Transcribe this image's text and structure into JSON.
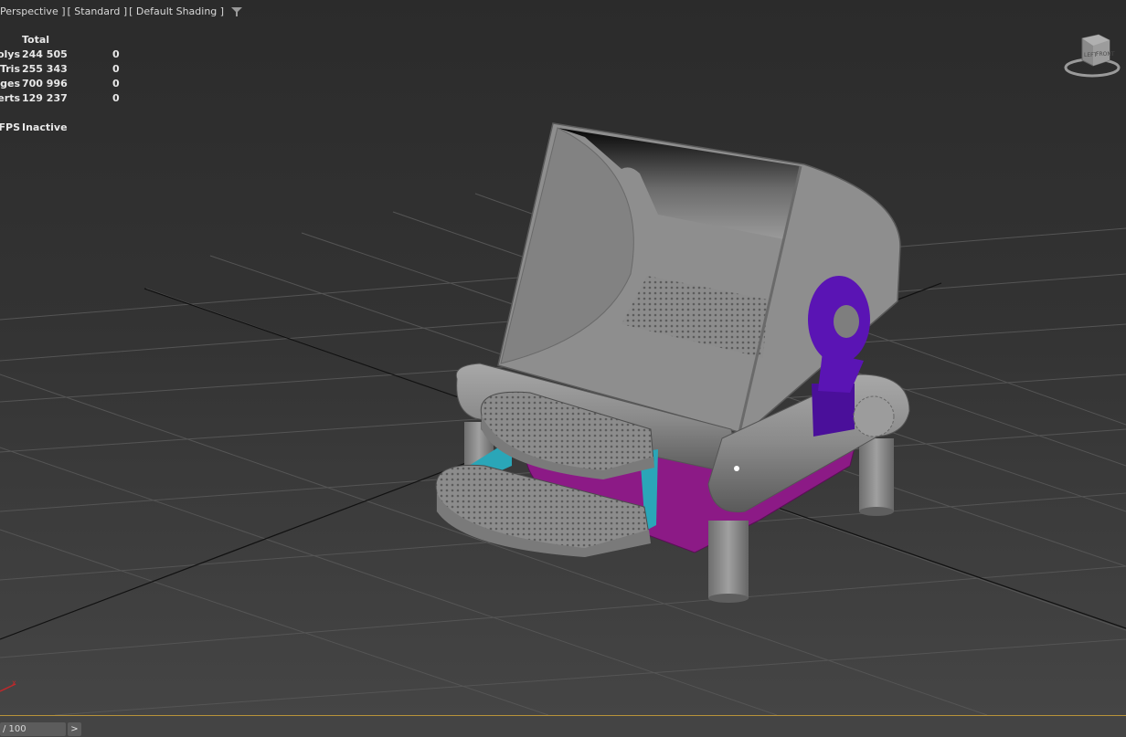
{
  "viewport": {
    "label_items": [
      "Perspective ]",
      "[ Standard ]",
      "[ Default Shading ]"
    ],
    "filter_icon": "filter-icon"
  },
  "stats": {
    "header": "Total",
    "rows": [
      {
        "label": "Polys:",
        "total": "244 505",
        "selected": "0"
      },
      {
        "label": "Tris:",
        "total": "255 343",
        "selected": "0"
      },
      {
        "label": "Edges:",
        "total": "700 996",
        "selected": "0"
      },
      {
        "label": "Verts:",
        "total": "129 237",
        "selected": "0"
      }
    ],
    "fps_label": "FPS:",
    "fps_value": "Inactive"
  },
  "viewcube": {
    "left": "LEFT",
    "front": "FRONT"
  },
  "timeline": {
    "frame": "/ 100",
    "next": ">"
  },
  "colors": {
    "model_gray": "#8e8e8e",
    "accent_purple": "#5a14b4",
    "accent_magenta": "#8c1a86",
    "accent_cyan": "#2aa6b8"
  }
}
